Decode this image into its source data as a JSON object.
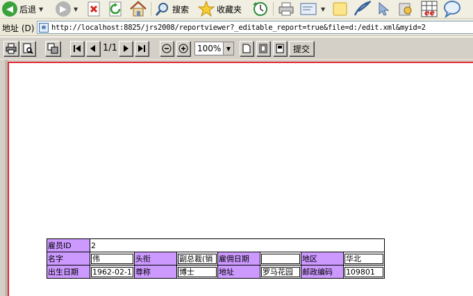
{
  "ie_toolbar": {
    "back_label": "后退",
    "search_label": "搜索",
    "favorites_label": "收藏夹"
  },
  "address_bar": {
    "label": "地址 (D)",
    "url": "http://localhost:8825/jrs2008/reportviewer?_editable_report=true&file=d:/edit.xml&myid=2"
  },
  "report_toolbar": {
    "page_indicator": "1/1",
    "zoom": "100%",
    "submit_label": "提交"
  },
  "report": {
    "row1": {
      "employee_id_label": "雇员ID",
      "employee_id_value": "2"
    },
    "row2": {
      "name_label": "名字",
      "name_value": "伟",
      "title_label": "头衔",
      "title_value": "副总裁(销",
      "hire_date_label": "雇佣日期",
      "hire_date_value": "",
      "region_label": "地区",
      "region_value": "华北"
    },
    "row3": {
      "birth_date_label": "出生日期",
      "birth_date_value": "1962-02-1",
      "honorific_label": "尊称",
      "honorific_value": "博士",
      "address_label": "地址",
      "address_value": "罗马花园",
      "postal_label": "邮政编码",
      "postal_value": "109801"
    }
  },
  "colors": {
    "label_cell_bg": "#cc99ff",
    "page_border": "#e0262f",
    "toolbar_bg": "#d4d0c8"
  }
}
